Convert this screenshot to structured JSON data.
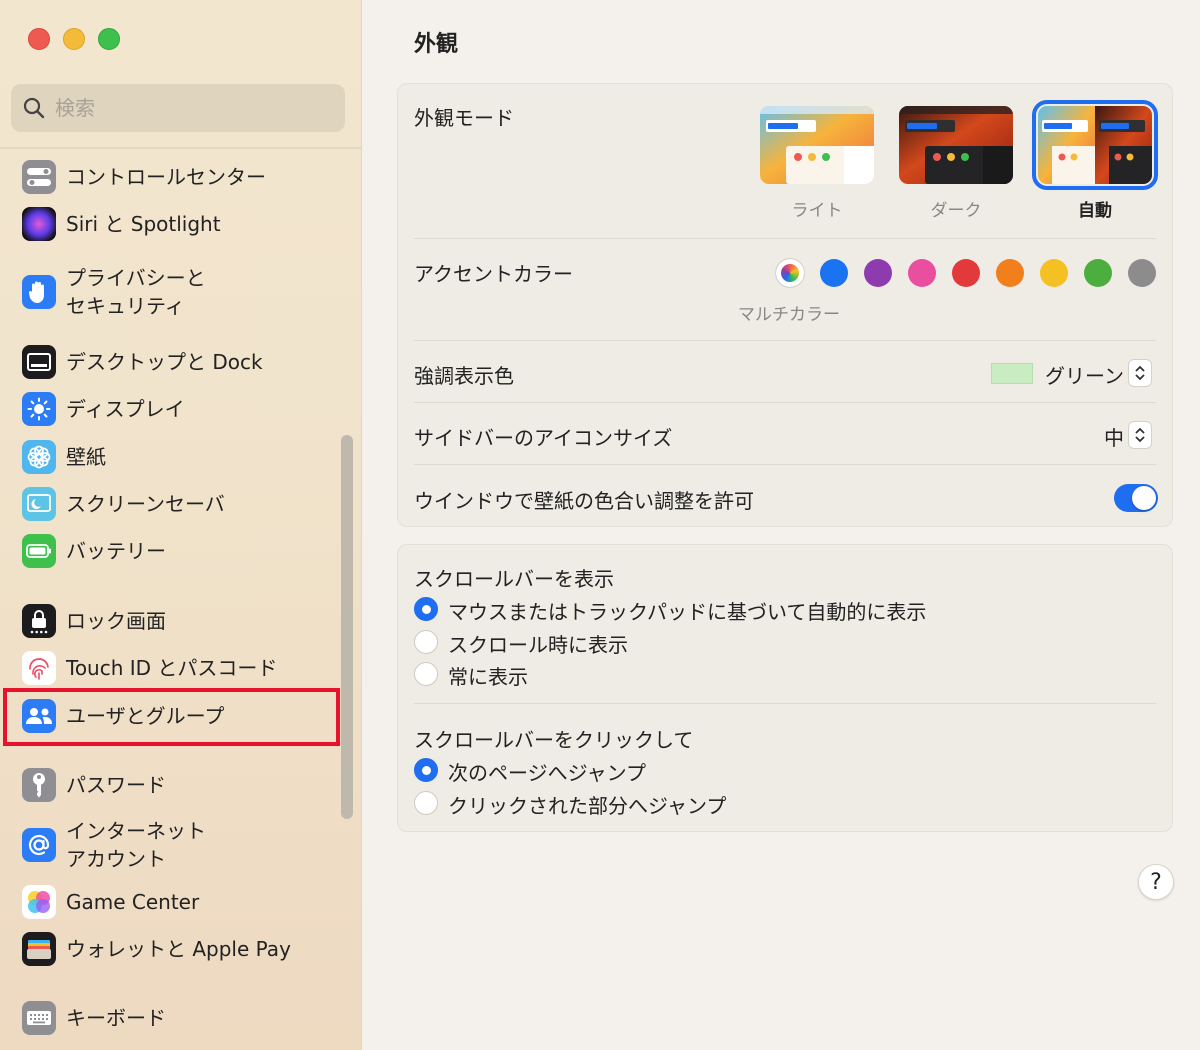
{
  "sidebar": {
    "search_placeholder": "検索",
    "items": [
      {
        "label": "コントロールセンター",
        "icon": "control-center-icon"
      },
      {
        "label": "Siri と Spotlight",
        "icon": "siri-icon"
      },
      {
        "label": "プライバシーと",
        "label2": "セキュリティ",
        "icon": "privacy-hand-icon"
      },
      {
        "label": "デスクトップと Dock",
        "icon": "desktop-dock-icon"
      },
      {
        "label": "ディスプレイ",
        "icon": "display-brightness-icon"
      },
      {
        "label": "壁紙",
        "icon": "wallpaper-flower-icon"
      },
      {
        "label": "スクリーンセーバ",
        "icon": "screensaver-icon"
      },
      {
        "label": "バッテリー",
        "icon": "battery-icon"
      },
      {
        "label": "ロック画面",
        "icon": "lock-screen-icon"
      },
      {
        "label": "Touch ID とパスコード",
        "icon": "fingerprint-icon"
      },
      {
        "label": "ユーザとグループ",
        "icon": "users-groups-icon"
      },
      {
        "label": "パスワード",
        "icon": "key-icon"
      },
      {
        "label": "インターネット",
        "label2": "アカウント",
        "icon": "at-sign-icon"
      },
      {
        "label": "Game Center",
        "icon": "game-center-icon"
      },
      {
        "label": "ウォレットと Apple Pay",
        "icon": "wallet-icon"
      },
      {
        "label": "キーボード",
        "icon": "keyboard-icon"
      }
    ]
  },
  "main": {
    "title": "外観",
    "appearance": {
      "label": "外観モード",
      "options": [
        {
          "label": "ライト",
          "selected": false
        },
        {
          "label": "ダーク",
          "selected": false
        },
        {
          "label": "自動",
          "selected": true
        }
      ]
    },
    "accent": {
      "label": "アクセントカラー",
      "selected_label": "マルチカラー",
      "colors": [
        "multicolor",
        "#1a73f0",
        "#8e3bb0",
        "#ea4f9f",
        "#e23a3a",
        "#f07f1c",
        "#f5c022",
        "#4cae3f",
        "#8c8c8c"
      ]
    },
    "highlight": {
      "label": "強調表示色",
      "value": "グリーン",
      "color": "#c9ecc3"
    },
    "sidebar_icon_size": {
      "label": "サイドバーのアイコンサイズ",
      "value": "中"
    },
    "wallpaper_tint": {
      "label": "ウインドウで壁紙の色合い調整を許可",
      "on": true
    },
    "show_scrollbars": {
      "label": "スクロールバーを表示",
      "options": [
        {
          "label": "マウスまたはトラックパッドに基づいて自動的に表示",
          "selected": true
        },
        {
          "label": "スクロール時に表示",
          "selected": false
        },
        {
          "label": "常に表示",
          "selected": false
        }
      ]
    },
    "click_scrollbar": {
      "label": "スクロールバーをクリックして",
      "options": [
        {
          "label": "次のページへジャンプ",
          "selected": true
        },
        {
          "label": "クリックされた部分へジャンプ",
          "selected": false
        }
      ]
    },
    "help": "?"
  },
  "colors": {
    "accent": "#1f6df0",
    "highlight_box": "#e6132c"
  }
}
